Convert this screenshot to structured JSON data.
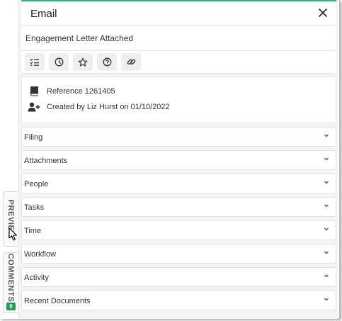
{
  "panel": {
    "title": "Email",
    "subject": "Engagement Letter Attached",
    "accent_color": "#2bb673"
  },
  "toolbar": {
    "buttons": [
      {
        "icon": "list-check-icon"
      },
      {
        "icon": "clock-icon"
      },
      {
        "icon": "star-icon"
      },
      {
        "icon": "help-circle-icon"
      },
      {
        "icon": "link-icon"
      }
    ]
  },
  "info": {
    "reference": "Reference 1261405",
    "created": "Created by Liz Hurst on 01/10/2022"
  },
  "sections": [
    {
      "label": "Filing"
    },
    {
      "label": "Attachments"
    },
    {
      "label": "People"
    },
    {
      "label": "Tasks"
    },
    {
      "label": "Time"
    },
    {
      "label": "Workflow"
    },
    {
      "label": "Activity"
    },
    {
      "label": "Recent Documents"
    }
  ],
  "side_tabs": {
    "preview": "PREVIEW",
    "comments": "COMMENTS",
    "comments_count": "0",
    "badge_color": "#1f9d57"
  }
}
